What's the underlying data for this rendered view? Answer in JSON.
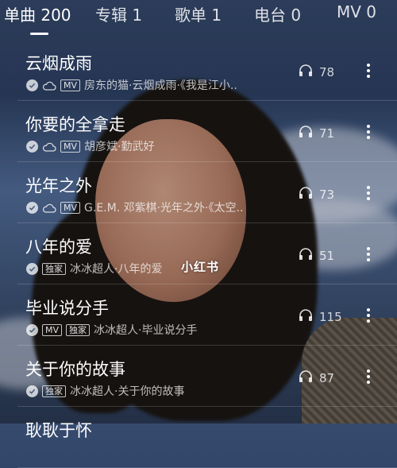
{
  "tabs": [
    {
      "label": "单曲 200",
      "active": true
    },
    {
      "label": "专辑 1",
      "active": false
    },
    {
      "label": "歌单 1",
      "active": false
    },
    {
      "label": "电台 0",
      "active": false
    },
    {
      "label": "MV 0",
      "active": false
    }
  ],
  "songs": [
    {
      "title": "云烟成雨",
      "tags": [
        "MV"
      ],
      "downloaded": true,
      "cloud": true,
      "artist": "房东的猫·云烟成雨·《我是江小..",
      "plays": "78"
    },
    {
      "title": "你要的全拿走",
      "tags": [
        "MV"
      ],
      "downloaded": true,
      "cloud": true,
      "artist": "胡彦斌·勤武好",
      "plays": "71"
    },
    {
      "title": "光年之外",
      "tags": [
        "MV"
      ],
      "downloaded": true,
      "cloud": true,
      "artist": "G.E.M. 邓紫棋·光年之外·《太空..",
      "plays": "73"
    },
    {
      "title": "八年的爱",
      "tags": [
        "独家"
      ],
      "downloaded": true,
      "cloud": false,
      "artist": "冰冰超人·八年的爱",
      "plays": "51"
    },
    {
      "title": "毕业说分手",
      "tags": [
        "MV",
        "独家"
      ],
      "downloaded": true,
      "cloud": false,
      "artist": "冰冰超人·毕业说分手",
      "plays": "115"
    },
    {
      "title": "关于你的故事",
      "tags": [
        "独家"
      ],
      "downloaded": true,
      "cloud": false,
      "artist": "冰冰超人·关于你的故事",
      "plays": "87"
    },
    {
      "title": "耿耿于怀",
      "tags": [],
      "downloaded": false,
      "cloud": false,
      "artist": "",
      "plays": ""
    }
  ],
  "watermark": "小红书",
  "icons": {
    "plays": "headphones-icon",
    "more": "more-vertical-icon",
    "downloaded": "check-circle-icon",
    "cloud": "cloud-icon"
  },
  "colors": {
    "text": "#ffffff",
    "secondary_text": "rgba(255,255,255,0.72)"
  }
}
